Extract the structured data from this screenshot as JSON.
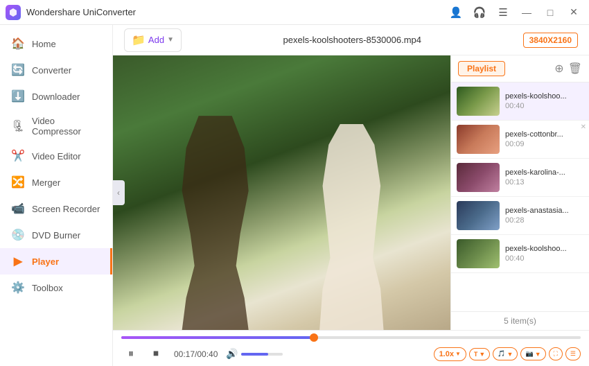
{
  "app": {
    "title": "Wondershare UniConverter",
    "logo_alt": "app-logo"
  },
  "titlebar": {
    "icons": [
      "user-icon",
      "headphone-icon",
      "menu-icon"
    ],
    "window_controls": [
      "minimize",
      "maximize",
      "close"
    ]
  },
  "sidebar": {
    "items": [
      {
        "id": "home",
        "label": "Home",
        "icon": "🏠"
      },
      {
        "id": "converter",
        "label": "Converter",
        "icon": "🔄"
      },
      {
        "id": "downloader",
        "label": "Downloader",
        "icon": "⬇️"
      },
      {
        "id": "video-compressor",
        "label": "Video Compressor",
        "icon": "🗜"
      },
      {
        "id": "video-editor",
        "label": "Video Editor",
        "icon": "✂️"
      },
      {
        "id": "merger",
        "label": "Merger",
        "icon": "🔀"
      },
      {
        "id": "screen-recorder",
        "label": "Screen Recorder",
        "icon": "📹"
      },
      {
        "id": "dvd-burner",
        "label": "DVD Burner",
        "icon": "💿"
      },
      {
        "id": "player",
        "label": "Player",
        "icon": "▶",
        "active": true
      },
      {
        "id": "toolbox",
        "label": "Toolbox",
        "icon": "⚙️"
      }
    ]
  },
  "topbar": {
    "add_button_label": "Add",
    "file_title": "pexels-koolshooters-8530006.mp4",
    "resolution": "3840X2160"
  },
  "player": {
    "current_time": "00:17",
    "total_time": "00:40",
    "progress_percent": 42,
    "volume_percent": 65,
    "speed": "1.0x"
  },
  "playlist": {
    "tab_label": "Playlist",
    "item_count": "5 item(s)",
    "items": [
      {
        "name": "pexels-koolshoo...",
        "duration": "00:40",
        "thumb": "thumb-gradient-1",
        "active": true
      },
      {
        "name": "pexels-cottonbr...",
        "duration": "00:09",
        "thumb": "thumb-gradient-2",
        "active": false
      },
      {
        "name": "pexels-karolina-...",
        "duration": "00:13",
        "thumb": "thumb-gradient-3",
        "active": false
      },
      {
        "name": "pexels-anastasia...",
        "duration": "00:28",
        "thumb": "thumb-gradient-4",
        "active": false
      },
      {
        "name": "pexels-koolshoo...",
        "duration": "00:40",
        "thumb": "thumb-gradient-5",
        "active": false
      }
    ]
  },
  "controls": {
    "play_icon": "⏸",
    "stop_icon": "⏹",
    "volume_icon": "🔊",
    "speed_label": "1.0x",
    "subtitle_icon": "T",
    "audio_icon": "🎵",
    "screenshot_icon": "📷",
    "fullscreen_icon": "⛶",
    "playlist_icon": "☰"
  }
}
